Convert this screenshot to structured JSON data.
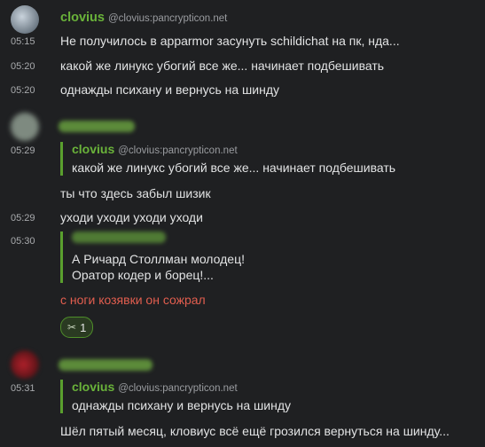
{
  "group1": {
    "name": "clovius",
    "user_id": "@clovius:pancrypticon.net",
    "messages": [
      {
        "time": "05:15",
        "text": "Не получилось в apparmor засунуть schildichat на пк, нда..."
      },
      {
        "time": "05:20",
        "text": "какой же линукс убогий все же... начинает подбешивать"
      },
      {
        "time": "05:20",
        "text": "однажды психану и вернусь на шинду"
      }
    ]
  },
  "group2": {
    "messages": [
      {
        "time": "05:29",
        "reply": {
          "name": "clovius",
          "user_id": "@clovius:pancrypticon.net",
          "text": "какой же линукс убогий все же... начинает подбешивать"
        },
        "text": ""
      },
      {
        "time": "",
        "text": "ты что здесь забыл шизик"
      },
      {
        "time": "05:29",
        "text": "уходи уходи уходи уходи"
      },
      {
        "time": "05:30",
        "reply": {
          "lines": [
            "А Ричард Столлман молодец!",
            "Оратор кодер и борец!..."
          ]
        },
        "text": ""
      },
      {
        "time": "",
        "text": "с ноги козявки он сожрал"
      }
    ],
    "reaction": {
      "icon": "scissors-icon",
      "count": "1"
    }
  },
  "group3": {
    "messages": [
      {
        "time": "05:31",
        "reply": {
          "name": "clovius",
          "user_id": "@clovius:pancrypticon.net",
          "text": "однажды психану и вернусь на шинду"
        },
        "text": ""
      },
      {
        "time": "",
        "text": "Шёл пятый месяц, кловиус всё ещё грозился вернуться на шинду..."
      }
    ]
  },
  "colors": {
    "background": "#1f2022",
    "sender": "#6ab33a",
    "reply_border": "#5a9f2e",
    "red_text": "#e25e4f"
  }
}
